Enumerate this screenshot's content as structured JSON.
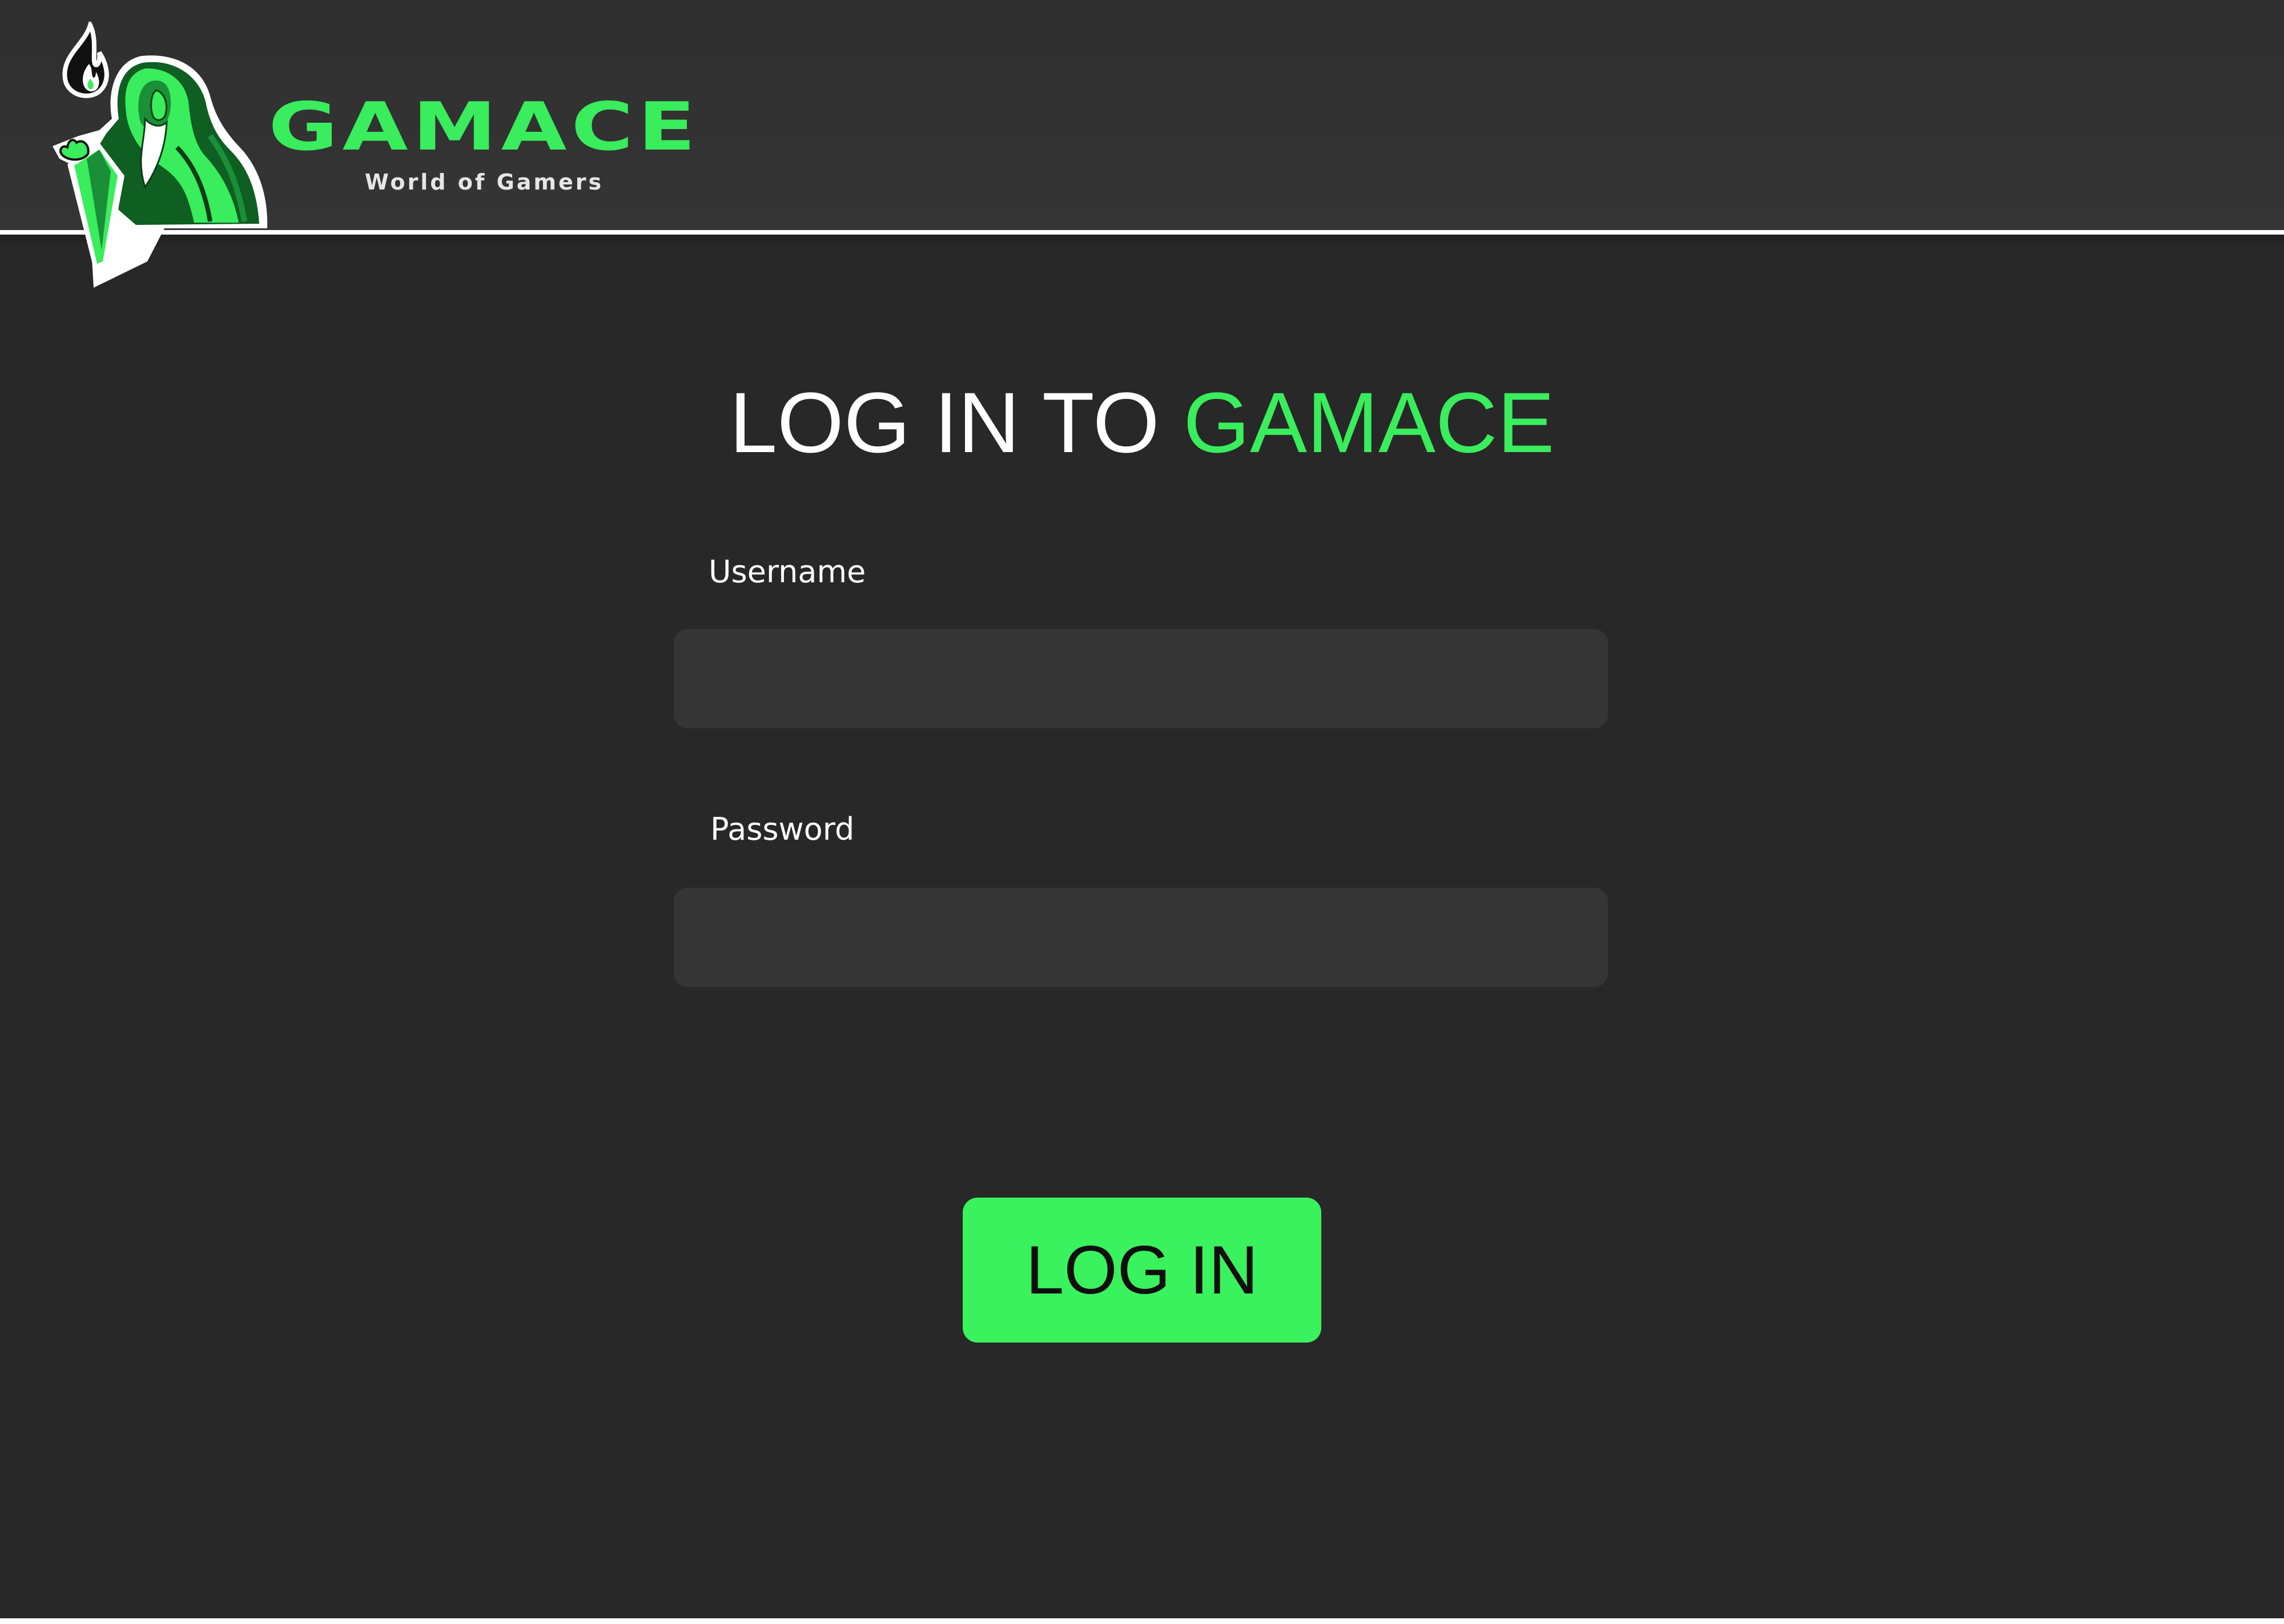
{
  "brand": {
    "name": "GAMACE",
    "tagline": "World of Gamers",
    "logo_icon": "hooded-wizard-mascot-icon",
    "accent_color": "#39ed5c"
  },
  "login": {
    "title_prefix": "LOG IN TO",
    "title_accent": "GAMACE",
    "username_label": "Username",
    "username_value": "",
    "username_placeholder": "",
    "password_label": "Password",
    "password_value": "",
    "password_placeholder": "",
    "button_label": "LOG IN",
    "button_color": "#39f25e"
  },
  "colors": {
    "background": "#282828",
    "header": "#323232",
    "input_background": "#353535",
    "text": "#ffffff"
  }
}
